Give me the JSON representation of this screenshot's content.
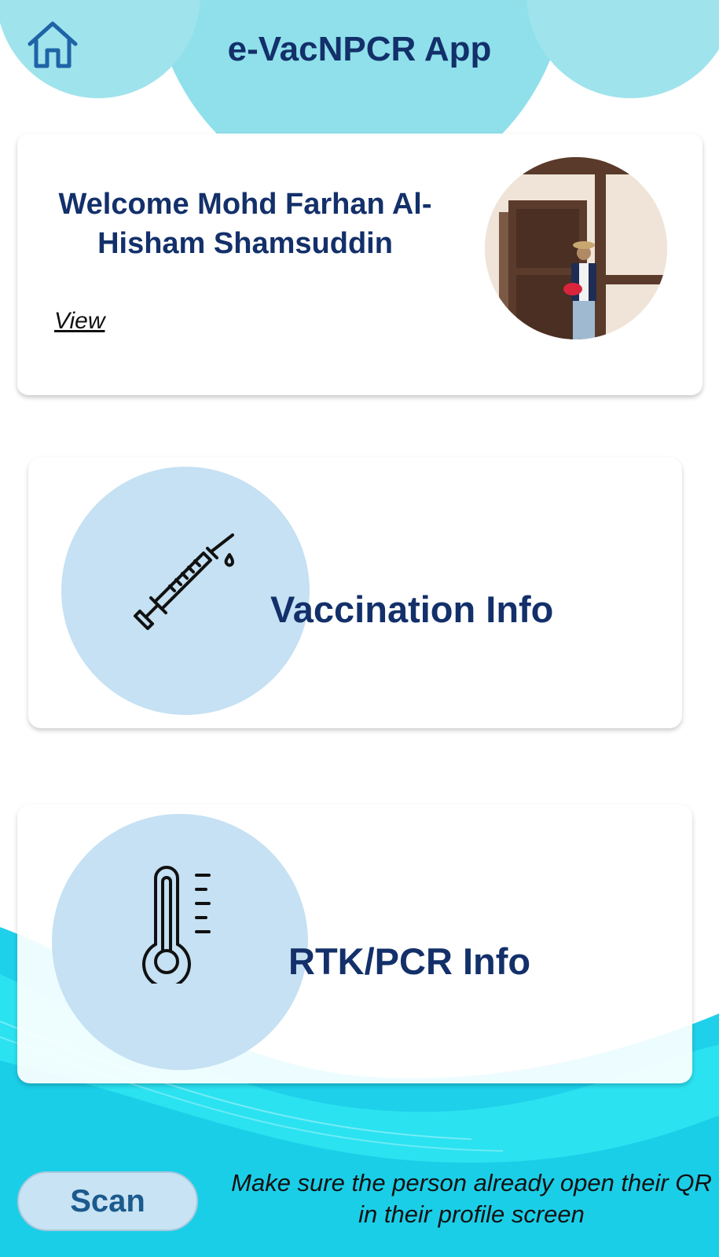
{
  "header": {
    "title": "e-VacNPCR App",
    "home_icon": "home-icon",
    "colors": {
      "bubble": "#9fe3ec",
      "title": "#13306a"
    }
  },
  "welcome": {
    "greeting": "Welcome Mohd Farhan Al-Hisham Shamsuddin",
    "view_label": "View"
  },
  "cards": {
    "vaccination": {
      "label": "Vaccination Info",
      "icon": "syringe-icon"
    },
    "rtk_pcr": {
      "label": "RTK/PCR Info",
      "icon": "thermometer-icon"
    }
  },
  "footer": {
    "scan_label": "Scan",
    "hint": "Make sure the person already open their QR in their profile screen"
  }
}
